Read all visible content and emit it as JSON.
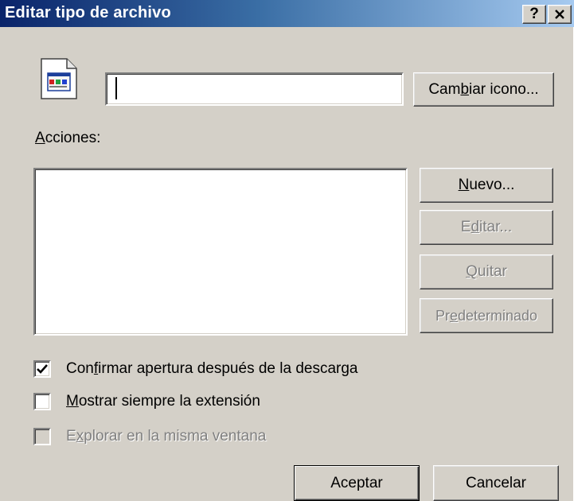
{
  "window": {
    "title": "Editar tipo de archivo",
    "help_label": "?",
    "close_label": "✕"
  },
  "file_type": {
    "name_value": "",
    "change_icon_button": {
      "pre": "Cam",
      "key": "b",
      "post": "iar icono..."
    }
  },
  "actions": {
    "label": {
      "key": "A",
      "post": "cciones:"
    },
    "items": [],
    "buttons": {
      "new": {
        "key": "N",
        "pre": "",
        "post": "uevo...",
        "enabled": true
      },
      "edit": {
        "key": "d",
        "pre": "E",
        "post": "itar...",
        "enabled": false
      },
      "remove": {
        "key": "Q",
        "pre": "",
        "post": "uitar",
        "enabled": false
      },
      "default": {
        "key": "e",
        "pre": "Pr",
        "post": "determinado",
        "enabled": false
      }
    }
  },
  "options": {
    "confirm_open": {
      "pre": "Con",
      "key": "f",
      "post": "irmar apertura después de la descarga",
      "checked": true,
      "enabled": true
    },
    "always_show_ext": {
      "pre": "",
      "key": "M",
      "post": "ostrar siempre la extensión",
      "checked": false,
      "enabled": true
    },
    "browse_same_window": {
      "pre": "E",
      "key": "x",
      "post": "plorar en la misma ventana",
      "checked": false,
      "enabled": false
    }
  },
  "footer": {
    "ok_label": "Aceptar",
    "cancel_label": "Cancelar"
  },
  "colors": {
    "face": "#d4d0c8",
    "title_start": "#0a246a",
    "title_end": "#a6caf0",
    "disabled_text": "#808080"
  }
}
